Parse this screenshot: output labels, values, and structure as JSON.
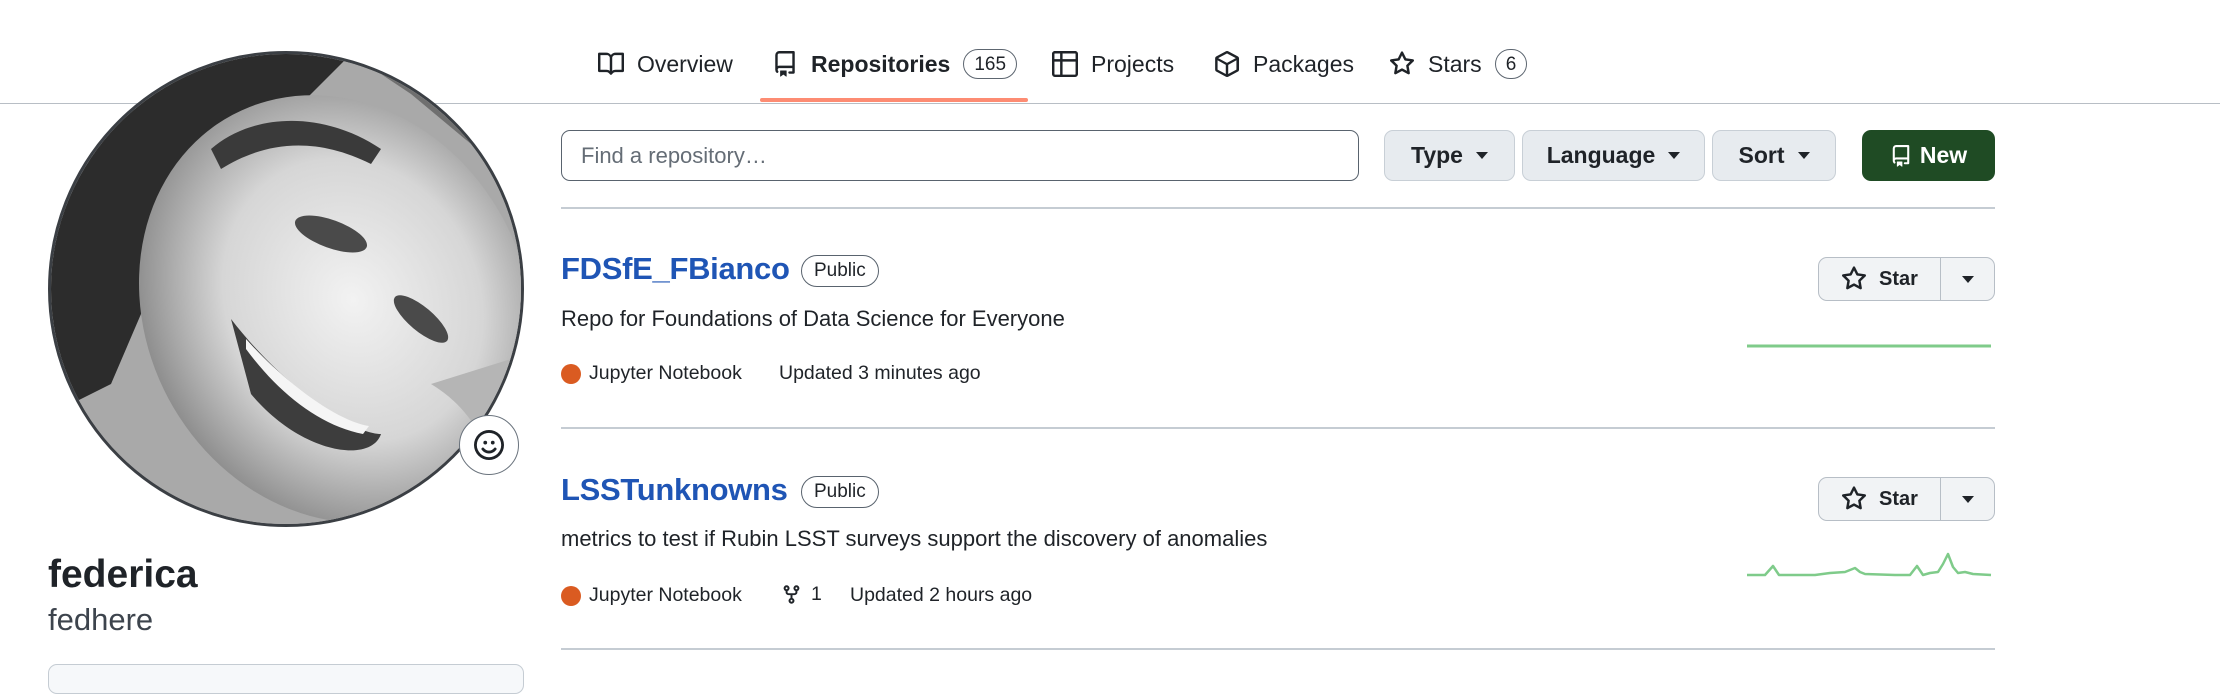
{
  "tabs": [
    {
      "label": "Overview",
      "icon": "book-icon"
    },
    {
      "label": "Repositories",
      "icon": "repo-icon",
      "count": "165"
    },
    {
      "label": "Projects",
      "icon": "table-icon"
    },
    {
      "label": "Packages",
      "icon": "package-icon"
    },
    {
      "label": "Stars",
      "icon": "star-icon",
      "count": "6"
    }
  ],
  "profile": {
    "name": "federica",
    "username": "fedhere"
  },
  "filters": {
    "search_placeholder": "Find a repository…",
    "type_label": "Type",
    "language_label": "Language",
    "sort_label": "Sort",
    "new_label": "New"
  },
  "repos": [
    {
      "name": "FDSfE_FBianco",
      "visibility": "Public",
      "description": "Repo for Foundations of Data Science for Everyone",
      "language": "Jupyter Notebook",
      "language_color": "#DA5B21",
      "updated": "Updated 3 minutes ago",
      "star_label": "Star"
    },
    {
      "name": "LSSTunknowns",
      "visibility": "Public",
      "description": "metrics to test if Rubin LSST surveys support the discovery of anomalies",
      "language": "Jupyter Notebook",
      "language_color": "#DA5B21",
      "forks": "1",
      "updated": "Updated 2 hours ago",
      "star_label": "Star"
    }
  ],
  "colors": {
    "accent_link": "#1F55B5",
    "tab_underline": "#FD8C73",
    "new_button": "#1F4B24",
    "sparkline": "#7FCB8A"
  }
}
